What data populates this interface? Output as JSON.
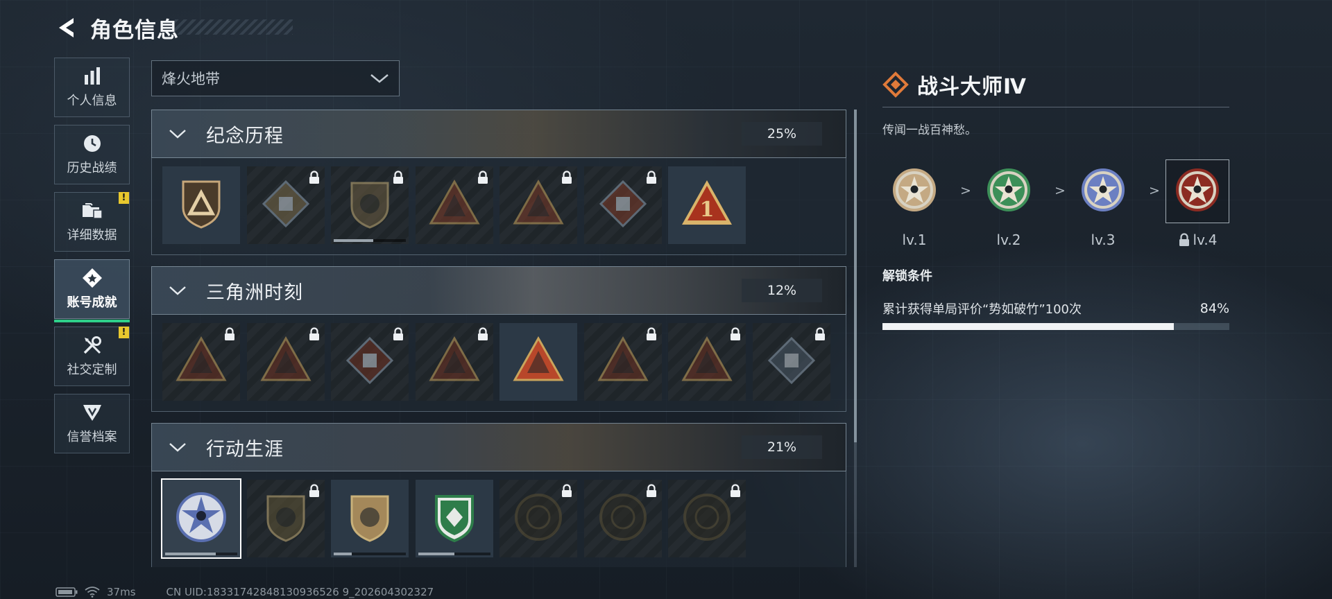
{
  "header": {
    "title": "角色信息"
  },
  "sidebar": {
    "items": [
      {
        "label": "个人信息",
        "icon": "bar-chart-icon"
      },
      {
        "label": "历史战绩",
        "icon": "clock-icon"
      },
      {
        "label": "详细数据",
        "icon": "folder-icon",
        "badge": "!"
      },
      {
        "label": "账号成就",
        "icon": "diamond-star-icon",
        "active": true
      },
      {
        "label": "社交定制",
        "icon": "tools-icon",
        "badge": "!"
      },
      {
        "label": "信誉档案",
        "icon": "shield-wing-icon"
      }
    ]
  },
  "filter": {
    "value": "烽火地带"
  },
  "sections": [
    {
      "title": "纪念历程",
      "progress": "25%",
      "badges": [
        {
          "icon": "triangle-shield-emblem-icon",
          "locked": false,
          "tint": "#c7a77a"
        },
        {
          "icon": "helicopter-emblem-icon",
          "locked": true,
          "tint": "#7a6a48"
        },
        {
          "icon": "hex-shield-emblem-icon",
          "locked": true,
          "tint": "#6b5c40",
          "fill": 0.55
        },
        {
          "icon": "skull-triangle-emblem-icon",
          "locked": true,
          "tint": "#7d3a28"
        },
        {
          "icon": "soldier-triangle-emblem-icon",
          "locked": true,
          "tint": "#7d3a28"
        },
        {
          "icon": "crossed-rifles-emblem-icon",
          "locked": true,
          "tint": "#7d3a28"
        },
        {
          "icon": "number-one-triangle-emblem-icon",
          "locked": false,
          "tint": "#a8331e"
        }
      ]
    },
    {
      "title": "三角洲时刻",
      "progress": "12%",
      "badges": [
        {
          "icon": "bag-triangle-emblem-icon",
          "locked": true,
          "tint": "#6e3020"
        },
        {
          "icon": "skull-triangle-emblem-icon",
          "locked": true,
          "tint": "#6e3020"
        },
        {
          "icon": "kneeling-soldier-emblem-icon",
          "locked": true,
          "tint": "#6e3020"
        },
        {
          "icon": "hands-triangle-emblem-icon",
          "locked": true,
          "tint": "#6e3020"
        },
        {
          "icon": "squad-triangle-emblem-icon",
          "locked": false,
          "tint": "#b8472a"
        },
        {
          "icon": "squad-triangle-emblem-icon",
          "locked": true,
          "tint": "#6e3020"
        },
        {
          "icon": "rider-triangle-emblem-icon",
          "locked": true,
          "tint": "#6e3020"
        },
        {
          "icon": "diamond-box-emblem-icon",
          "locked": true,
          "tint": "#4a5866"
        }
      ]
    },
    {
      "title": "行动生涯",
      "progress": "21%",
      "badges": [
        {
          "icon": "blue-star-medal-icon",
          "locked": false,
          "selected": true,
          "tint": "#5a6fb0",
          "fill": 0.7
        },
        {
          "icon": "dark-shield-emblem-icon",
          "locked": true,
          "tint": "#5e5335"
        },
        {
          "icon": "gold-shield-emblem-icon",
          "locked": false,
          "tint": "#a4885a",
          "fill": 0.25
        },
        {
          "icon": "green-shield-emblem-icon",
          "locked": false,
          "tint": "#2e7d4a",
          "fill": 0.5
        },
        {
          "icon": "circle-helmet-emblem-icon",
          "locked": true,
          "tint": "#5a5034"
        },
        {
          "icon": "circle-target-emblem-icon",
          "locked": true,
          "tint": "#5a5034"
        },
        {
          "icon": "circle-eye-emblem-icon",
          "locked": true,
          "tint": "#5a5034"
        }
      ]
    }
  ],
  "detail": {
    "title": "战斗大师Ⅳ",
    "icon": "orange-diamond-icon",
    "description": "传闻一战百神愁。",
    "levels": [
      {
        "label": "lv.1",
        "tint": "#c4a983",
        "locked": false
      },
      {
        "label": "lv.2",
        "tint": "#3c8f58",
        "locked": false
      },
      {
        "label": "lv.3",
        "tint": "#6b7fc2",
        "locked": false
      },
      {
        "label": "lv.4",
        "tint": "#8c2b22",
        "locked": true,
        "current": true
      }
    ],
    "arrow": ">",
    "unlock_title": "解锁条件",
    "condition": {
      "text": "累计获得单局评价“势如破竹”100次",
      "percent": "84%",
      "value": 0.84
    }
  },
  "footer": {
    "ping": "37ms",
    "uid": "CN UID:18331742848130936526 9_202604302327"
  },
  "colors": {
    "accent_green": "#2fd08a",
    "alert_yellow": "#e8c82e",
    "detail_orange": "#e07a3a"
  }
}
